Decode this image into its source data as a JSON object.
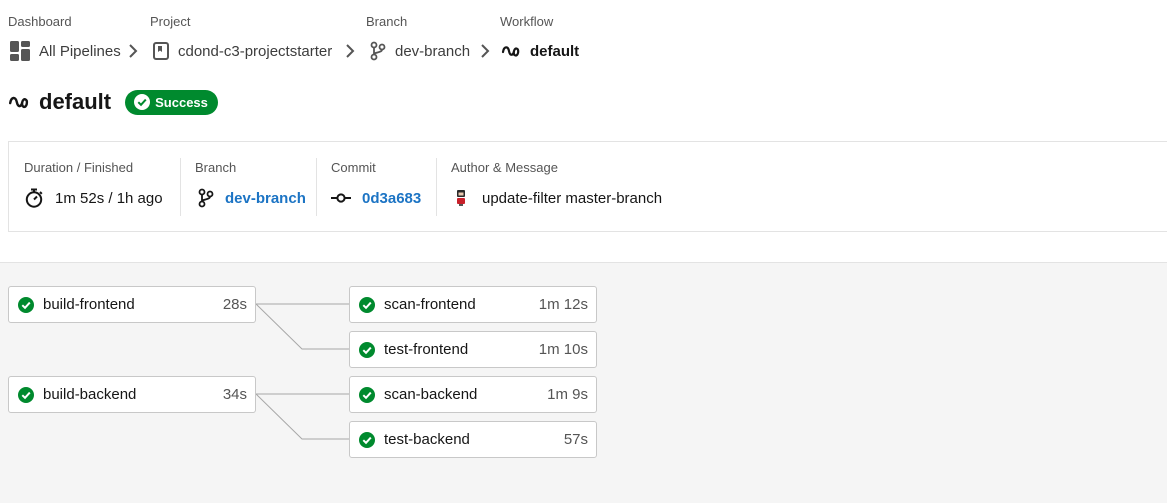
{
  "breadcrumb": {
    "dashboard": {
      "label": "Dashboard",
      "value": "All Pipelines"
    },
    "project": {
      "label": "Project",
      "value": "cdond-c3-projectstarter"
    },
    "branch": {
      "label": "Branch",
      "value": "dev-branch"
    },
    "workflow": {
      "label": "Workflow",
      "value": "default"
    }
  },
  "workflow": {
    "title": "default",
    "status": "Success"
  },
  "summary": {
    "duration": {
      "label": "Duration / Finished",
      "value": "1m 52s / 1h ago"
    },
    "branch": {
      "label": "Branch",
      "value": "dev-branch"
    },
    "commit": {
      "label": "Commit",
      "value": "0d3a683"
    },
    "author": {
      "label": "Author & Message",
      "message": "update-filter master-branch"
    }
  },
  "jobs": [
    {
      "name": "build-frontend",
      "duration": "28s",
      "status": "success"
    },
    {
      "name": "scan-frontend",
      "duration": "1m 12s",
      "status": "success"
    },
    {
      "name": "test-frontend",
      "duration": "1m 10s",
      "status": "success"
    },
    {
      "name": "build-backend",
      "duration": "34s",
      "status": "success"
    },
    {
      "name": "scan-backend",
      "duration": "1m 9s",
      "status": "success"
    },
    {
      "name": "test-backend",
      "duration": "57s",
      "status": "success"
    }
  ],
  "colors": {
    "success": "#008a2e",
    "link": "#1c74c4",
    "text": "#161616",
    "muted": "#555555"
  }
}
